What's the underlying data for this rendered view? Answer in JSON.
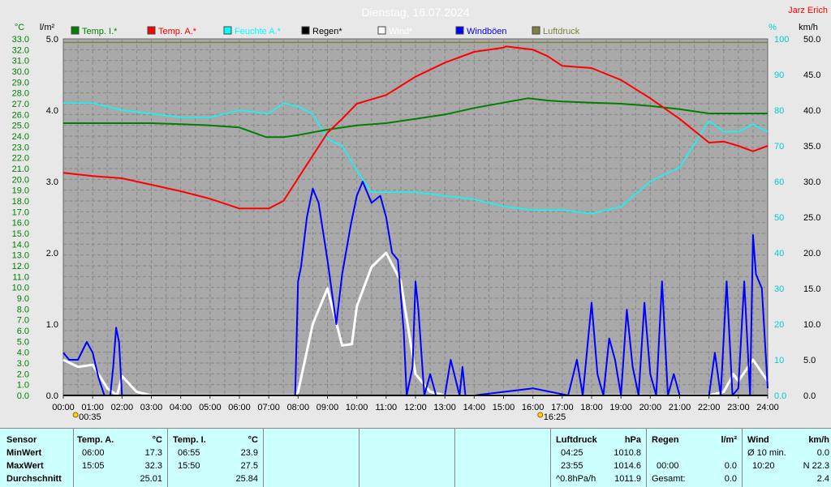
{
  "header": {
    "title": "Dienstag, 16.07.2024",
    "author": "Jarz Erich"
  },
  "axes": {
    "temp_unit": "°C",
    "rain_unit": "l/m²",
    "hum_unit": "%",
    "wind_unit": "km/h",
    "temp_ticks": [
      "0.0",
      "1.0",
      "2.0",
      "3.0",
      "4.0",
      "5.0",
      "6.0",
      "7.0",
      "8.0",
      "9.0",
      "10.0",
      "11.0",
      "12.0",
      "13.0",
      "14.0",
      "15.0",
      "16.0",
      "17.0",
      "18.0",
      "19.0",
      "20.0",
      "21.0",
      "22.0",
      "23.0",
      "24.0",
      "25.0",
      "26.0",
      "27.0",
      "28.0",
      "29.0",
      "30.0",
      "31.0",
      "32.0",
      "33.0"
    ],
    "rain_ticks": [
      "0.0",
      "1.0",
      "2.0",
      "3.0",
      "4.0",
      "5.0"
    ],
    "hum_ticks": [
      "0.0",
      "10",
      "20",
      "30",
      "40",
      "50",
      "60",
      "70",
      "80",
      "90",
      "100"
    ],
    "wind_ticks": [
      "0.0",
      "5.0",
      "10.0",
      "15.0",
      "20.0",
      "25.0",
      "30.0",
      "35.0",
      "40.0",
      "45.0",
      "50.0"
    ],
    "time_ticks": [
      "00:00",
      "01:00",
      "02:00",
      "03:00",
      "04:00",
      "05:00",
      "06:00",
      "07:00",
      "08:00",
      "09:00",
      "10:00",
      "11:00",
      "12:00",
      "13:00",
      "14:00",
      "15:00",
      "16:00",
      "17:00",
      "18:00",
      "19:00",
      "20:00",
      "21:00",
      "22:00",
      "23:00",
      "24:00"
    ],
    "sunrise": "00:35",
    "sunset": "16:25"
  },
  "legend": [
    {
      "label": "Temp. I.*",
      "color": "#008000"
    },
    {
      "label": "Temp. A.*",
      "color": "#ff0000"
    },
    {
      "label": "Feuchte A.*",
      "color": "#00ffff"
    },
    {
      "label": "Regen*",
      "color": "#000000"
    },
    {
      "label": "Wind*",
      "color": "#ffffff"
    },
    {
      "label": "Windböen",
      "color": "#0000ff"
    },
    {
      "label": "Luftdruck",
      "color": "#808040"
    }
  ],
  "chart_data": {
    "type": "line",
    "title": "Dienstag, 16.07.2024",
    "x_range_hours": [
      0,
      24
    ],
    "y_left_temp_range": [
      0,
      33
    ],
    "y_rain_range": [
      0,
      5
    ],
    "y_humidity_range": [
      0,
      100
    ],
    "y_wind_range": [
      0,
      50
    ],
    "grid": true,
    "series": [
      {
        "name": "Temp. I.*",
        "axis": "temp",
        "color": "#008000",
        "x": [
          0,
          1,
          2,
          3,
          4,
          5,
          6,
          6.917,
          7.5,
          8,
          9,
          10,
          11,
          12,
          13,
          14,
          15,
          15.833,
          16.5,
          17,
          18,
          19,
          20,
          21,
          22,
          23,
          24
        ],
        "y": [
          25.2,
          25.2,
          25.2,
          25.2,
          25.1,
          25.0,
          24.8,
          23.9,
          23.9,
          24.1,
          24.6,
          25.0,
          25.2,
          25.6,
          26.0,
          26.6,
          27.1,
          27.5,
          27.3,
          27.2,
          27.1,
          27.0,
          26.8,
          26.5,
          26.1,
          26.1,
          26.1
        ]
      },
      {
        "name": "Temp. A.*",
        "axis": "temp",
        "color": "#ff0000",
        "x": [
          0,
          1,
          2,
          3,
          4,
          5,
          6,
          7,
          7.5,
          8,
          8.5,
          9,
          9.5,
          10,
          11,
          12,
          13,
          14,
          15,
          15.083,
          16,
          16.5,
          17,
          18,
          19,
          20,
          21,
          22,
          22.5,
          23,
          23.5,
          24
        ],
        "y": [
          20.6,
          20.3,
          20.1,
          19.5,
          18.9,
          18.2,
          17.3,
          17.3,
          18.0,
          20.1,
          22.2,
          24.3,
          25.6,
          27.0,
          27.8,
          29.5,
          30.8,
          31.8,
          32.2,
          32.3,
          32.0,
          31.4,
          30.5,
          30.3,
          29.2,
          27.5,
          25.6,
          23.4,
          23.5,
          23.1,
          22.6,
          23.1
        ]
      },
      {
        "name": "Feuchte A.*",
        "axis": "humidity",
        "color": "#00ffff",
        "x": [
          0,
          1,
          2,
          3,
          4,
          5,
          6,
          7,
          7.5,
          8,
          8.5,
          9,
          9.5,
          10,
          10.5,
          11,
          12,
          13,
          14,
          15,
          16,
          17,
          18,
          19,
          20,
          21,
          22,
          22.5,
          23,
          23.5,
          24
        ],
        "y": [
          82,
          82,
          80,
          79,
          78,
          78,
          80,
          79,
          82,
          81,
          79,
          72,
          70,
          63,
          57,
          57,
          57,
          56,
          55,
          53,
          52,
          52,
          51,
          53,
          60,
          64,
          77,
          74,
          74,
          76,
          74
        ]
      },
      {
        "name": "Luftdruck",
        "axis": "pressure_band",
        "color": "#808040",
        "x": [
          0,
          2,
          4,
          6,
          8,
          10,
          12,
          14,
          16,
          18,
          20,
          22,
          24
        ],
        "y": [
          99,
          99,
          99,
          99,
          99,
          99,
          99,
          99,
          99,
          99,
          99,
          99,
          99
        ]
      },
      {
        "name": "Wind*",
        "axis": "wind",
        "color": "#ffffff",
        "x": [
          0,
          0.5,
          1,
          1.5,
          1.833,
          2,
          2.5,
          3,
          7.917,
          8,
          8.5,
          9,
          9.5,
          9.833,
          10,
          10.5,
          11,
          11.5,
          12,
          12.5,
          13,
          14,
          20,
          22,
          22.5,
          22.833,
          23,
          23.5,
          24
        ],
        "y": [
          5.0,
          4.0,
          4.3,
          1.0,
          0.0,
          2.7,
          0.5,
          0.0,
          0.0,
          0.5,
          10.0,
          15.0,
          7.0,
          7.2,
          12.5,
          18.0,
          20.0,
          16.0,
          3.0,
          0.5,
          0.0,
          0.0,
          0.0,
          0.0,
          0.5,
          3.0,
          2.0,
          5.0,
          2.0
        ]
      },
      {
        "name": "Windböen",
        "axis": "wind",
        "color": "#0000ff",
        "x": [
          0,
          0.2,
          0.5,
          0.8,
          1,
          1.2,
          1.4,
          1.5,
          1.6,
          1.7,
          1.8,
          1.9,
          2,
          2.1,
          2.3,
          2.5,
          7.9,
          8,
          8.1,
          8.3,
          8.5,
          8.7,
          9,
          9.3,
          9.5,
          9.8,
          10,
          10.2,
          10.5,
          10.8,
          11,
          11.2,
          11.4,
          11.6,
          11.7,
          11.9,
          12,
          12.1,
          12.3,
          12.5,
          12.7,
          13,
          13.2,
          13.5,
          13.6,
          13.7,
          14,
          16,
          17.2,
          17.5,
          17.7,
          18,
          18.2,
          18.4,
          18.6,
          18.8,
          19,
          19.2,
          19.4,
          19.6,
          19.8,
          20,
          20.2,
          20.4,
          20.6,
          20.8,
          21,
          21.5,
          22,
          22.2,
          22.4,
          22.6,
          22.8,
          23,
          23.2,
          23.4,
          23.5,
          23.6,
          23.8,
          24
        ],
        "y": [
          6.0,
          5.0,
          5.0,
          7.5,
          6.0,
          2.5,
          0.0,
          0.0,
          0.0,
          4.0,
          9.5,
          7.5,
          0.0,
          0.0,
          0.0,
          0.0,
          0.0,
          16.0,
          18.0,
          25.0,
          29.0,
          27.0,
          19.0,
          10.0,
          17.0,
          24.0,
          28.0,
          30.0,
          27.0,
          28.0,
          25.0,
          20.0,
          19.0,
          9.0,
          0.0,
          4.0,
          16.0,
          12.0,
          0.0,
          3.0,
          0.0,
          0.0,
          5.0,
          0.0,
          4.0,
          0.0,
          0.0,
          1.0,
          0.0,
          5.0,
          0.0,
          13.0,
          3.0,
          0.0,
          8.0,
          5.0,
          0.0,
          12.0,
          4.0,
          0.0,
          13.0,
          3.0,
          0.0,
          16.0,
          0.0,
          3.0,
          0.0,
          0.0,
          0.0,
          6.0,
          0.0,
          16.0,
          0.0,
          1.0,
          16.0,
          0.0,
          22.5,
          17.0,
          15.0,
          1.0
        ]
      },
      {
        "name": "Regen*",
        "axis": "rain",
        "color": "#000000",
        "x": [
          0,
          24
        ],
        "y": [
          0.0,
          0.0
        ]
      }
    ]
  },
  "table": {
    "sections": [
      {
        "id": "sensor",
        "heading": "Sensor",
        "rows": [
          "MinWert",
          "MaxWert",
          "Durchschnitt"
        ]
      },
      {
        "id": "temp_a",
        "heading": "Temp. A.",
        "unit": "°C",
        "rows": [
          [
            "06:00",
            "17.3"
          ],
          [
            "15:05",
            "32.3"
          ],
          [
            "",
            "25.01"
          ]
        ]
      },
      {
        "id": "temp_i",
        "heading": "Temp. I.",
        "unit": "°C",
        "rows": [
          [
            "06:55",
            "23.9"
          ],
          [
            "15:50",
            "27.5"
          ],
          [
            "",
            "25.84"
          ]
        ]
      },
      {
        "id": "luftdruck",
        "heading": "Luftdruck",
        "unit": "hPa",
        "rows": [
          [
            "04:25",
            "1010.8"
          ],
          [
            "23:55",
            "1014.6"
          ],
          [
            "^0.8hPa/h",
            "1011.9"
          ]
        ]
      },
      {
        "id": "regen",
        "heading": "Regen",
        "unit": "l/m²",
        "rows": [
          [
            "",
            ""
          ],
          [
            "00:00",
            "0.0"
          ],
          [
            "Gesamt:",
            "0.0"
          ]
        ]
      },
      {
        "id": "wind",
        "heading": "Wind",
        "unit": "km/h",
        "rows": [
          [
            "Ø 10 min.",
            "0.0"
          ],
          [
            "10:20",
            "N 22.3"
          ],
          [
            "",
            "2.4"
          ]
        ]
      }
    ]
  }
}
